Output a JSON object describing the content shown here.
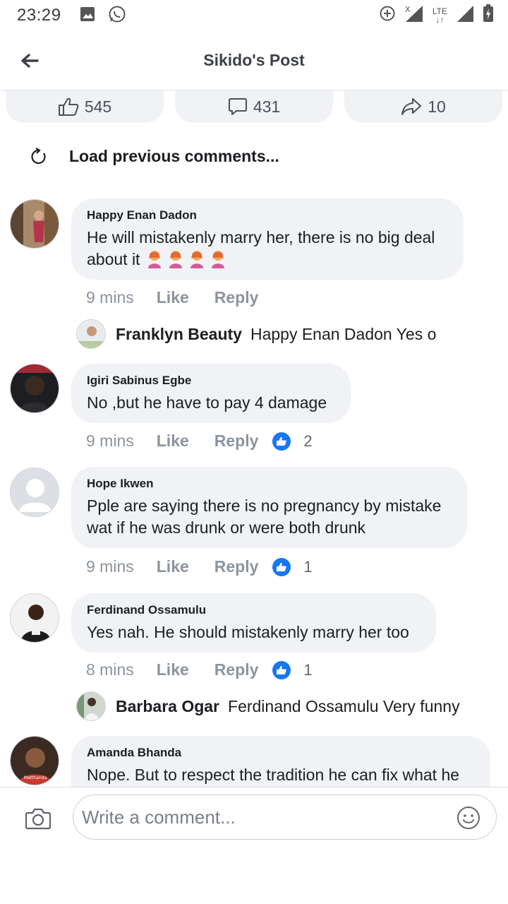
{
  "status_bar": {
    "time": "23:29",
    "network": "LTE"
  },
  "header": {
    "title": "Sikido's Post"
  },
  "actions": {
    "likes": "545",
    "comments": "431",
    "shares": "10"
  },
  "load_previous": "Load previous comments...",
  "comments": [
    {
      "name": "Happy Enan Dadon",
      "text": "He will mistakenly marry her, there is no big deal",
      "text2": "about it",
      "time": "9 mins",
      "like": "Like",
      "reply": "Reply",
      "reactions": ""
    },
    {
      "name": "Igiri Sabinus Egbe",
      "text": "No ,but he have to pay 4 damage",
      "time": "9 mins",
      "like": "Like",
      "reply": "Reply",
      "reactions": "2"
    },
    {
      "name": "Hope Ikwen",
      "text": "Pple are saying there is no pregnancy by mistake wat if he was drunk or were both drunk",
      "time": "9 mins",
      "like": "Like",
      "reply": "Reply",
      "reactions": "1"
    },
    {
      "name": "Ferdinand Ossamulu",
      "text": "Yes nah. He should mistakenly marry her too",
      "time": "8 mins",
      "like": "Like",
      "reply": "Reply",
      "reactions": "1"
    },
    {
      "name": "Amanda Bhanda",
      "text": "Nope. But to respect the tradition he can fix what he",
      "avatar_caption": "Matthanda"
    }
  ],
  "replies": [
    {
      "name": "Franklyn Beauty",
      "text": "Happy Enan Dadon Yes o"
    },
    {
      "name": "Barbara Ogar",
      "text": "Ferdinand Ossamulu Very funny"
    }
  ],
  "comment_bar": {
    "placeholder": "Write a comment..."
  },
  "colors": {
    "bubble": "#f0f2f5",
    "like_blue": "#1877f2",
    "meta_gray": "#8d949e"
  }
}
